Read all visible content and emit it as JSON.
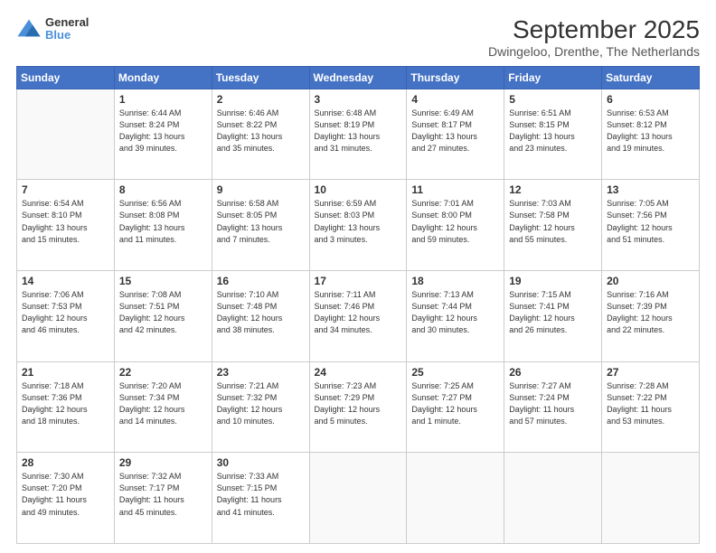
{
  "logo": {
    "line1": "General",
    "line2": "Blue"
  },
  "title": "September 2025",
  "subtitle": "Dwingeloo, Drenthe, The Netherlands",
  "weekdays": [
    "Sunday",
    "Monday",
    "Tuesday",
    "Wednesday",
    "Thursday",
    "Friday",
    "Saturday"
  ],
  "weeks": [
    [
      {
        "day": "",
        "info": ""
      },
      {
        "day": "1",
        "info": "Sunrise: 6:44 AM\nSunset: 8:24 PM\nDaylight: 13 hours\nand 39 minutes."
      },
      {
        "day": "2",
        "info": "Sunrise: 6:46 AM\nSunset: 8:22 PM\nDaylight: 13 hours\nand 35 minutes."
      },
      {
        "day": "3",
        "info": "Sunrise: 6:48 AM\nSunset: 8:19 PM\nDaylight: 13 hours\nand 31 minutes."
      },
      {
        "day": "4",
        "info": "Sunrise: 6:49 AM\nSunset: 8:17 PM\nDaylight: 13 hours\nand 27 minutes."
      },
      {
        "day": "5",
        "info": "Sunrise: 6:51 AM\nSunset: 8:15 PM\nDaylight: 13 hours\nand 23 minutes."
      },
      {
        "day": "6",
        "info": "Sunrise: 6:53 AM\nSunset: 8:12 PM\nDaylight: 13 hours\nand 19 minutes."
      }
    ],
    [
      {
        "day": "7",
        "info": "Sunrise: 6:54 AM\nSunset: 8:10 PM\nDaylight: 13 hours\nand 15 minutes."
      },
      {
        "day": "8",
        "info": "Sunrise: 6:56 AM\nSunset: 8:08 PM\nDaylight: 13 hours\nand 11 minutes."
      },
      {
        "day": "9",
        "info": "Sunrise: 6:58 AM\nSunset: 8:05 PM\nDaylight: 13 hours\nand 7 minutes."
      },
      {
        "day": "10",
        "info": "Sunrise: 6:59 AM\nSunset: 8:03 PM\nDaylight: 13 hours\nand 3 minutes."
      },
      {
        "day": "11",
        "info": "Sunrise: 7:01 AM\nSunset: 8:00 PM\nDaylight: 12 hours\nand 59 minutes."
      },
      {
        "day": "12",
        "info": "Sunrise: 7:03 AM\nSunset: 7:58 PM\nDaylight: 12 hours\nand 55 minutes."
      },
      {
        "day": "13",
        "info": "Sunrise: 7:05 AM\nSunset: 7:56 PM\nDaylight: 12 hours\nand 51 minutes."
      }
    ],
    [
      {
        "day": "14",
        "info": "Sunrise: 7:06 AM\nSunset: 7:53 PM\nDaylight: 12 hours\nand 46 minutes."
      },
      {
        "day": "15",
        "info": "Sunrise: 7:08 AM\nSunset: 7:51 PM\nDaylight: 12 hours\nand 42 minutes."
      },
      {
        "day": "16",
        "info": "Sunrise: 7:10 AM\nSunset: 7:48 PM\nDaylight: 12 hours\nand 38 minutes."
      },
      {
        "day": "17",
        "info": "Sunrise: 7:11 AM\nSunset: 7:46 PM\nDaylight: 12 hours\nand 34 minutes."
      },
      {
        "day": "18",
        "info": "Sunrise: 7:13 AM\nSunset: 7:44 PM\nDaylight: 12 hours\nand 30 minutes."
      },
      {
        "day": "19",
        "info": "Sunrise: 7:15 AM\nSunset: 7:41 PM\nDaylight: 12 hours\nand 26 minutes."
      },
      {
        "day": "20",
        "info": "Sunrise: 7:16 AM\nSunset: 7:39 PM\nDaylight: 12 hours\nand 22 minutes."
      }
    ],
    [
      {
        "day": "21",
        "info": "Sunrise: 7:18 AM\nSunset: 7:36 PM\nDaylight: 12 hours\nand 18 minutes."
      },
      {
        "day": "22",
        "info": "Sunrise: 7:20 AM\nSunset: 7:34 PM\nDaylight: 12 hours\nand 14 minutes."
      },
      {
        "day": "23",
        "info": "Sunrise: 7:21 AM\nSunset: 7:32 PM\nDaylight: 12 hours\nand 10 minutes."
      },
      {
        "day": "24",
        "info": "Sunrise: 7:23 AM\nSunset: 7:29 PM\nDaylight: 12 hours\nand 5 minutes."
      },
      {
        "day": "25",
        "info": "Sunrise: 7:25 AM\nSunset: 7:27 PM\nDaylight: 12 hours\nand 1 minute."
      },
      {
        "day": "26",
        "info": "Sunrise: 7:27 AM\nSunset: 7:24 PM\nDaylight: 11 hours\nand 57 minutes."
      },
      {
        "day": "27",
        "info": "Sunrise: 7:28 AM\nSunset: 7:22 PM\nDaylight: 11 hours\nand 53 minutes."
      }
    ],
    [
      {
        "day": "28",
        "info": "Sunrise: 7:30 AM\nSunset: 7:20 PM\nDaylight: 11 hours\nand 49 minutes."
      },
      {
        "day": "29",
        "info": "Sunrise: 7:32 AM\nSunset: 7:17 PM\nDaylight: 11 hours\nand 45 minutes."
      },
      {
        "day": "30",
        "info": "Sunrise: 7:33 AM\nSunset: 7:15 PM\nDaylight: 11 hours\nand 41 minutes."
      },
      {
        "day": "",
        "info": ""
      },
      {
        "day": "",
        "info": ""
      },
      {
        "day": "",
        "info": ""
      },
      {
        "day": "",
        "info": ""
      }
    ]
  ]
}
